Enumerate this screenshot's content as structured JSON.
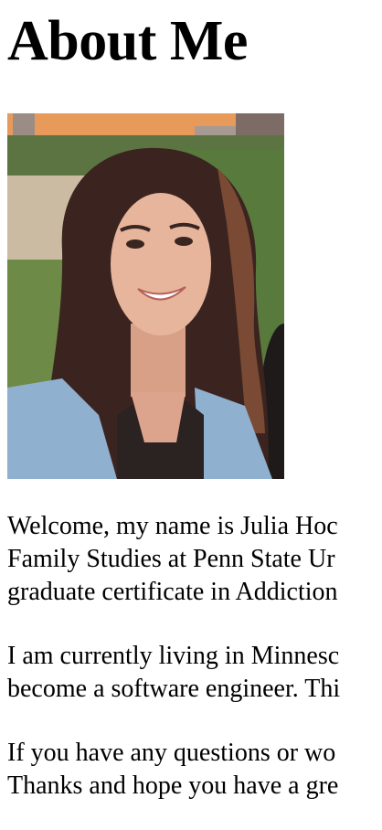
{
  "page": {
    "heading": "About Me",
    "photo": {
      "subject": "portrait-photo",
      "colors": {
        "sky": "#e89a5a",
        "buildings": "#8a7a74",
        "foliage": "#5f7d3c",
        "water": "#c9b9a0",
        "hair": "#3b2420",
        "skin": "#e7b59c",
        "denim": "#8fb0cf",
        "top": "#2b2222"
      }
    },
    "paragraphs": [
      {
        "lines": [
          "Welcome, my name is Julia Hoc",
          "Family Studies at Penn State Ur",
          "graduate certificate in Addiction"
        ]
      },
      {
        "lines": [
          "I am currently living in Minnesc",
          "become a software engineer. Thi"
        ]
      },
      {
        "lines": [
          "If you have any questions or wo",
          "Thanks and hope you have a gre"
        ]
      }
    ]
  }
}
